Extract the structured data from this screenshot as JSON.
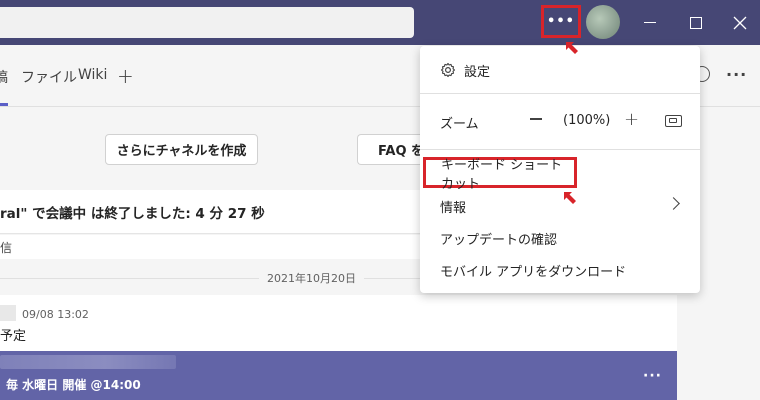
{
  "colors": {
    "titlebar": "#464775",
    "accent": "#6264a7",
    "highlight": "#d8242a"
  },
  "titlebar": {
    "more_label": "•••"
  },
  "tabs": {
    "post": "稿",
    "files": "ファイル",
    "wiki": "Wiki",
    "add": "+",
    "more": "···"
  },
  "main": {
    "create_channel_button": "さらにチャネルを作成",
    "faq_button": "FAQ を",
    "meeting_status": "ral\" で会議中 は終了しました: 4 分 27 秒",
    "meeting_sub": "信",
    "date_divider": "2021年10月20日",
    "post_time": "09/08 13:02",
    "post_text": "予定",
    "banner_text": "毎 水曜日 開催 @14:00",
    "banner_more": "···"
  },
  "menu": {
    "settings": "設定",
    "zoom_label": "ズーム",
    "zoom_value": "(100%)",
    "keyboard_shortcuts": "キーボード ショートカット",
    "info": "情報",
    "check_updates": "アップデートの確認",
    "download_mobile": "モバイル アプリをダウンロード"
  }
}
